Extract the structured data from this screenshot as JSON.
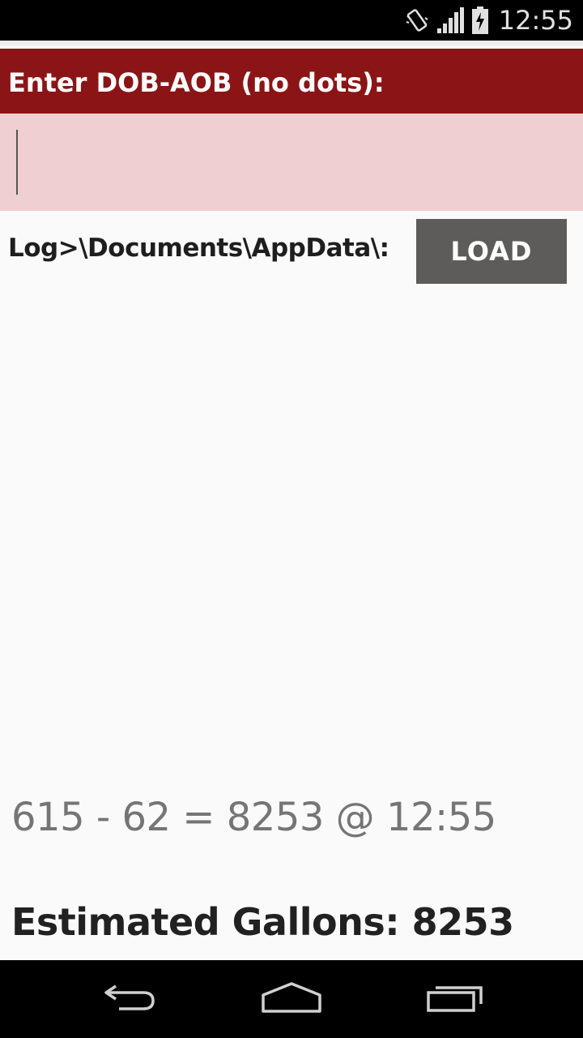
{
  "status_bar": {
    "time": "12:55",
    "icons": [
      "vibrate-icon",
      "signal-icon",
      "battery-charging-icon"
    ]
  },
  "header": {
    "title": "Enter DOB-AOB (no dots):"
  },
  "dob_input": {
    "value": "",
    "placeholder": ""
  },
  "log": {
    "label": "Log>\\Documents\\AppData\\:",
    "load_button_label": "LOAD"
  },
  "result": {
    "line": "615 - 62 = 8253 @ 12:55"
  },
  "estimate": {
    "line": "Estimated Gallons: 8253"
  },
  "nav_bar": {
    "buttons": [
      "back-icon",
      "home-icon",
      "recents-icon"
    ]
  },
  "colors": {
    "header_bg": "#8b1516",
    "input_bg": "#efcfd1",
    "button_bg": "#5e5c5a",
    "page_bg": "#fafafa"
  }
}
